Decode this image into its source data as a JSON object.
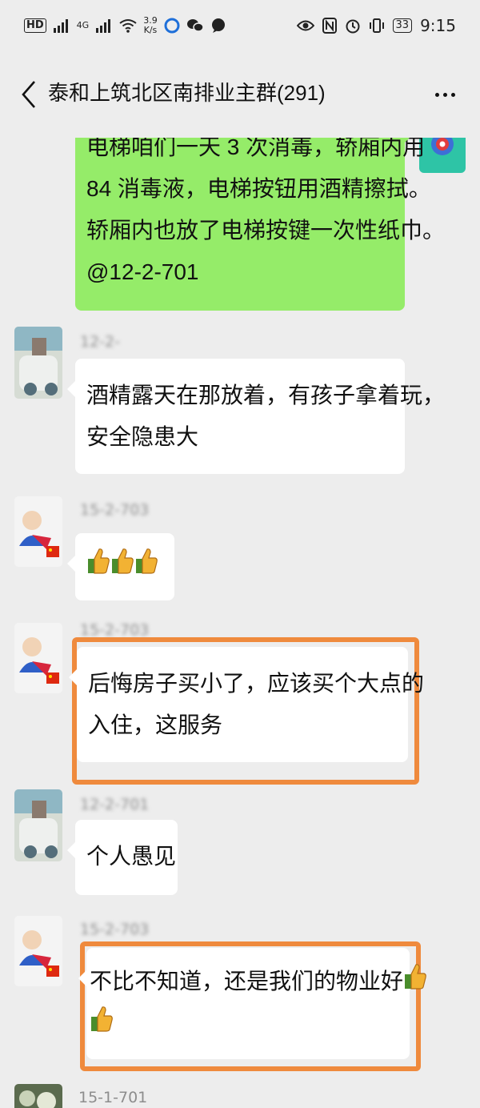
{
  "status_bar": {
    "network_label": "HD",
    "network_gen": "4G",
    "speed_value": "3.9",
    "speed_unit": "K/s",
    "battery": "33",
    "time": "9:15"
  },
  "header": {
    "title": "泰和上筑北区南排业主群(291)"
  },
  "messages": [
    {
      "sender": "self",
      "lines": [
        "电梯咱们一天 3 次消毒，轿厢内用",
        "84 消毒液，电梯按钮用酒精擦拭。",
        "轿厢内也放了电梯按键一次性纸巾。",
        "@12-2-701"
      ]
    },
    {
      "sender": "other",
      "nickname": "12-2-",
      "lines": [
        "酒精露天在那放着，有孩子拿着玩，",
        "安全隐患大"
      ]
    },
    {
      "sender": "other",
      "nickname": "15-2-703",
      "emoji": [
        "thumbs-up",
        "thumbs-up",
        "thumbs-up"
      ]
    },
    {
      "sender": "other",
      "nickname": "15-2-703",
      "lines": [
        "后悔房子买小了，应该买个大点的",
        "入住，这服务"
      ],
      "highlighted": true
    },
    {
      "sender": "other",
      "nickname": "12-2-701",
      "lines": [
        "个人愚见"
      ]
    },
    {
      "sender": "other",
      "nickname": "15-2-703",
      "lines": [
        "不比不知道，还是我们的物业好"
      ],
      "trailing_emoji": [
        "thumbs-up",
        "thumbs-up"
      ],
      "highlighted": true
    },
    {
      "sender": "other",
      "nickname": "15-1-701"
    }
  ],
  "colors": {
    "background": "#ededed",
    "self_bubble": "#95ec69",
    "other_bubble": "#ffffff",
    "highlight_border": "#ef8a3d"
  }
}
